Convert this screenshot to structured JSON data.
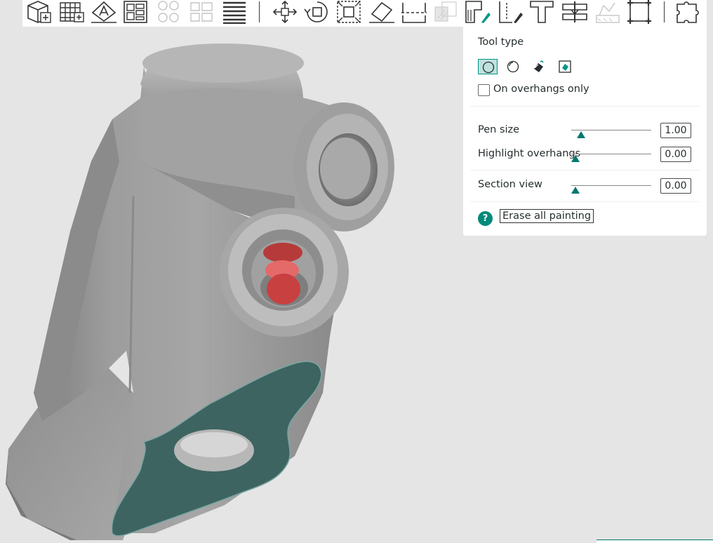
{
  "toolbar": {
    "icons": [
      "add-object-icon",
      "add-plate-icon",
      "auto-orient-icon",
      "arrange-icon",
      "layout-grid-icon",
      "split-icon",
      "layers-icon",
      "move-icon",
      "rotate-icon",
      "scale-icon",
      "lay-on-face-icon",
      "cut-icon",
      "boolean-icon",
      "support-paint-icon",
      "seam-paint-icon",
      "text-emboss-icon",
      "measure-icon",
      "fuzzy-skin-icon",
      "assembly-icon",
      "puzzle-icon"
    ]
  },
  "paint_panel": {
    "tool_type_label": "Tool type",
    "tools": [
      "circle-brush-icon",
      "sphere-brush-icon",
      "fill-bucket-icon",
      "gap-fill-icon"
    ],
    "active_tool": "circle-brush-icon",
    "on_overhangs_only_label": "On overhangs only",
    "on_overhangs_only_checked": false,
    "pen_size_label": "Pen size",
    "pen_size_value": "1.00",
    "highlight_overhangs_label": "Highlight overhangs",
    "highlight_overhangs_value": "0.00",
    "section_view_label": "Section view",
    "section_view_value": "0.00",
    "help_glyph": "?",
    "erase_button_label": "Erase all painting"
  },
  "colors": {
    "accent": "#009688",
    "accent_dark": "#00796b",
    "model_face": "#9a9a9a",
    "section_fill": "#3e6461",
    "painted_red": "#d84a4a",
    "viewport_bg": "#e5e5e5"
  }
}
